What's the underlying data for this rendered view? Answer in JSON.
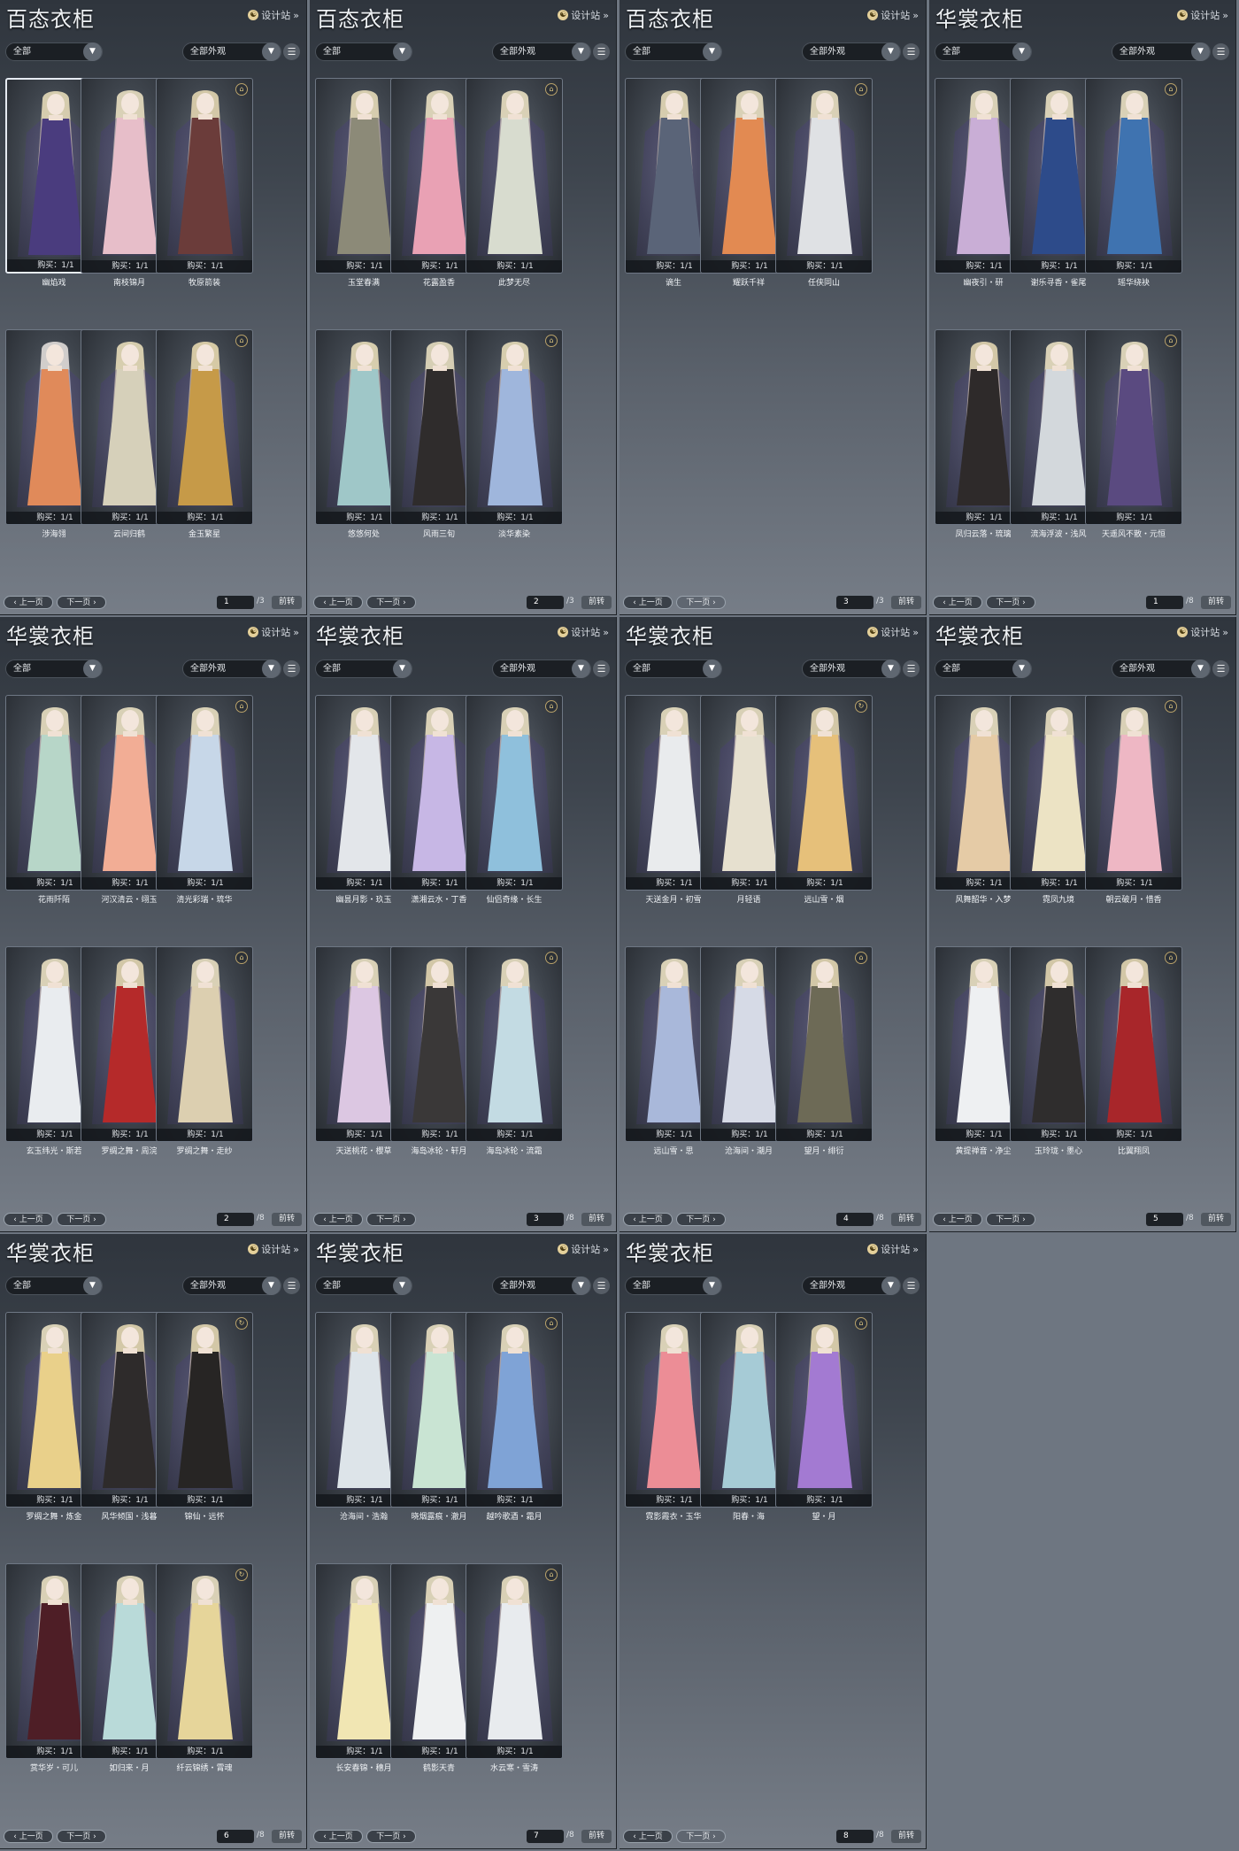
{
  "ui": {
    "design_link": "设计站",
    "filter_all": "全部",
    "filter_all_looks": "全部外观",
    "buy_prefix": "购买：",
    "buy_count": "1/1",
    "prev_page": "上一页",
    "next_page": "下一页",
    "jump": "前转"
  },
  "panels": [
    {
      "title": "百态衣柜",
      "page": "1",
      "total": "/3",
      "next_active": false,
      "selected": 0,
      "items": [
        {
          "name": "幽焰戏",
          "dress": "#4a3c7e",
          "hair": "#e5dab8",
          "icon": "lock"
        },
        {
          "name": "南枝锦月",
          "dress": "#e7bec9",
          "hair": "#e9dfc1",
          "icon": "lock"
        },
        {
          "name": "牧原箭装",
          "dress": "#6b3c3a",
          "hair": "#e2d5b0",
          "icon": "lock"
        },
        {
          "name": "涉海翎",
          "dress": "#e08a5a",
          "hair": "#e0dcd8",
          "icon": "none"
        },
        {
          "name": "云间归鹤",
          "dress": "#d6d0ba",
          "hair": "#e7dcb8",
          "icon": "lock"
        },
        {
          "name": "金玉繁星",
          "dress": "#c69a48",
          "hair": "#e5d7ae",
          "icon": "lock"
        }
      ]
    },
    {
      "title": "百态衣柜",
      "page": "2",
      "total": "/3",
      "next_active": false,
      "selected": -1,
      "items": [
        {
          "name": "玉堂春满",
          "dress": "#8c8a78",
          "hair": "#e5dab8",
          "icon": "lock"
        },
        {
          "name": "花露盈香",
          "dress": "#e9a1b4",
          "hair": "#e9dfc1",
          "icon": "lock"
        },
        {
          "name": "此梦无尽",
          "dress": "#d8dccf",
          "hair": "#e9dfc1",
          "icon": "lock"
        },
        {
          "name": "悠悠何处",
          "dress": "#9fc7c8",
          "hair": "#e7dcb8",
          "icon": "lock"
        },
        {
          "name": "风雨三旬",
          "dress": "#2f2c2c",
          "hair": "#e6ddbf",
          "icon": "lock"
        },
        {
          "name": "淡华素染",
          "dress": "#9fb6dc",
          "hair": "#e7dcb8",
          "icon": "lock"
        }
      ]
    },
    {
      "title": "百态衣柜",
      "page": "3",
      "total": "/3",
      "next_active": true,
      "selected": -1,
      "items": [
        {
          "name": "谪生",
          "dress": "#5a6478",
          "hair": "#e5dab8",
          "icon": "none"
        },
        {
          "name": "耀跃千祥",
          "dress": "#e28a52",
          "hair": "#e9dfc1",
          "icon": "lock"
        },
        {
          "name": "任侠同山",
          "dress": "#dfe1e4",
          "hair": "#e9dfc1",
          "icon": "lock"
        }
      ]
    },
    {
      "title": "华裳衣柜",
      "page": "1",
      "total": "/8",
      "next_active": false,
      "selected": -1,
      "items": [
        {
          "name": "幽夜引・研",
          "dress": "#c9aed6",
          "hair": "#e9dfc1",
          "icon": "lock"
        },
        {
          "name": "谢乐寻香・雀尾",
          "dress": "#2d4b8a",
          "hair": "#e9dfc1",
          "icon": "lock"
        },
        {
          "name": "瑶华绕袂",
          "dress": "#3f73b0",
          "hair": "#e9dfc1",
          "icon": "lock"
        },
        {
          "name": "凤归云落・琉璃",
          "dress": "#2e2a2a",
          "hair": "#e2d5b0",
          "icon": "lock"
        },
        {
          "name": "流海浮波・浅风",
          "dress": "#d3d8dc",
          "hair": "#e9dfc1",
          "icon": "lock"
        },
        {
          "name": "天遥风不散・元恒",
          "dress": "#5a4a80",
          "hair": "#e9dfc1",
          "icon": "lock"
        }
      ]
    },
    {
      "title": "华裳衣柜",
      "page": "2",
      "total": "/8",
      "next_active": false,
      "selected": -1,
      "items": [
        {
          "name": "花雨阡陌",
          "dress": "#b7d6c8",
          "hair": "#e9dfc1",
          "icon": "lock"
        },
        {
          "name": "河汉清云・翊玉",
          "dress": "#f2ad95",
          "hair": "#e9dfc1",
          "icon": "lock"
        },
        {
          "name": "清光彩瑞・琉华",
          "dress": "#c7d7e8",
          "hair": "#e9dfc1",
          "icon": "lock"
        },
        {
          "name": "玄玉纬光・斯若",
          "dress": "#e9ecef",
          "hair": "#e9dfc1",
          "icon": "lock"
        },
        {
          "name": "罗绸之舞・周浣",
          "dress": "#b52a2a",
          "hair": "#e2d5b0",
          "icon": "lock"
        },
        {
          "name": "罗绸之舞・走纱",
          "dress": "#dccfb0",
          "hair": "#e9dfc1",
          "icon": "lock"
        }
      ]
    },
    {
      "title": "华裳衣柜",
      "page": "3",
      "total": "/8",
      "next_active": false,
      "selected": -1,
      "items": [
        {
          "name": "幽昙月影・玖玉",
          "dress": "#e3e6ea",
          "hair": "#e9dfc1",
          "icon": "lock"
        },
        {
          "name": "潇湘云水・丁香",
          "dress": "#c7b7e5",
          "hair": "#e9dfc1",
          "icon": "lock"
        },
        {
          "name": "仙侣奇缘・长生",
          "dress": "#8fc0dc",
          "hair": "#e9dfc1",
          "icon": "lock"
        },
        {
          "name": "天送桃花・櫻草",
          "dress": "#dcc7e2",
          "hair": "#e9dfc1",
          "icon": "lock"
        },
        {
          "name": "海岛冰轮・轩月",
          "dress": "#3a3838",
          "hair": "#e2d5b0",
          "icon": "lock"
        },
        {
          "name": "海岛冰轮・流霜",
          "dress": "#c3dbe3",
          "hair": "#e9dfc1",
          "icon": "lock"
        }
      ]
    },
    {
      "title": "华裳衣柜",
      "page": "4",
      "total": "/8",
      "next_active": false,
      "selected": -1,
      "items": [
        {
          "name": "天送金月・初雪",
          "dress": "#e9ebed",
          "hair": "#e9dfc1",
          "icon": "lock"
        },
        {
          "name": "月轻语",
          "dress": "#e6e0cf",
          "hair": "#e9dfc1",
          "icon": "lock"
        },
        {
          "name": "远山雪・烟",
          "dress": "#e6c07a",
          "hair": "#e2d5b0",
          "icon": "refresh"
        },
        {
          "name": "远山雪・思",
          "dress": "#a9b8da",
          "hair": "#e9dfc1",
          "icon": "refresh"
        },
        {
          "name": "沧海间・潮月",
          "dress": "#d6dae6",
          "hair": "#e9dfc1",
          "icon": "lock"
        },
        {
          "name": "望月・绯衍",
          "dress": "#6d6a56",
          "hair": "#e2d5b0",
          "icon": "lock"
        }
      ]
    },
    {
      "title": "华裳衣柜",
      "page": "5",
      "total": "/8",
      "next_active": false,
      "selected": -1,
      "items": [
        {
          "name": "风舞韶华・入梦",
          "dress": "#e5cba6",
          "hair": "#e9dfc1",
          "icon": "lock"
        },
        {
          "name": "霓凤九境",
          "dress": "#ece3c4",
          "hair": "#e9dfc1",
          "icon": "lock"
        },
        {
          "name": "朝云破月・惜香",
          "dress": "#eeb7c4",
          "hair": "#e9dfc1",
          "icon": "lock"
        },
        {
          "name": "黄提禅音・净尘",
          "dress": "#eef0f2",
          "hair": "#e9dfc1",
          "icon": "lock"
        },
        {
          "name": "玉玲珑・墨心",
          "dress": "#2f2d2d",
          "hair": "#e2d5b0",
          "icon": "lock"
        },
        {
          "name": "比翼翔凤",
          "dress": "#a8262a",
          "hair": "#e2d5b0",
          "icon": "lock"
        }
      ]
    },
    {
      "title": "华裳衣柜",
      "page": "6",
      "total": "/8",
      "next_active": false,
      "selected": -1,
      "items": [
        {
          "name": "罗绸之舞・炼金",
          "dress": "#e9d08a",
          "hair": "#e9dfc1",
          "icon": "lock"
        },
        {
          "name": "风华倾国・浅暮",
          "dress": "#2e2b2b",
          "hair": "#e2d5b0",
          "icon": "lock"
        },
        {
          "name": "锦仙・远怀",
          "dress": "#272524",
          "hair": "#e2d5b0",
          "icon": "refresh"
        },
        {
          "name": "赏华岁・可儿",
          "dress": "#4e1e26",
          "hair": "#e9dfc1",
          "icon": "refresh"
        },
        {
          "name": "如归来・月",
          "dress": "#b9dad9",
          "hair": "#e9dfc1",
          "icon": "lock"
        },
        {
          "name": "纤云锦绣・霄魂",
          "dress": "#e6d59a",
          "hair": "#e9dfc1",
          "icon": "refresh"
        }
      ]
    },
    {
      "title": "华裳衣柜",
      "page": "7",
      "total": "/8",
      "next_active": false,
      "selected": -1,
      "items": [
        {
          "name": "沧海间・浩瀚",
          "dress": "#dde4e9",
          "hair": "#e9dfc1",
          "icon": "refresh"
        },
        {
          "name": "晓烟露痕・澈月",
          "dress": "#c9e4d3",
          "hair": "#e9dfc1",
          "icon": "lock"
        },
        {
          "name": "越吟歌酒・霜月",
          "dress": "#7fa3d6",
          "hair": "#e9dfc1",
          "icon": "lock"
        },
        {
          "name": "长安春锦・穗月",
          "dress": "#f1e6b3",
          "hair": "#e9dfc1",
          "icon": "lock"
        },
        {
          "name": "鹤影天青",
          "dress": "#eef0f1",
          "hair": "#e9dfc1",
          "icon": "lock"
        },
        {
          "name": "水云寒・雪涛",
          "dress": "#e8ebee",
          "hair": "#e9dfc1",
          "icon": "lock"
        }
      ]
    },
    {
      "title": "华裳衣柜",
      "page": "8",
      "total": "/8",
      "next_active": true,
      "selected": -1,
      "items": [
        {
          "name": "霓影霞衣・玉华",
          "dress": "#ec8d96",
          "hair": "#e9dfc1",
          "icon": "refresh"
        },
        {
          "name": "阳春・海",
          "dress": "#a6cbd6",
          "hair": "#e9dfc1",
          "icon": "lock"
        },
        {
          "name": "望・月",
          "dress": "#a37ad2",
          "hair": "#e2d5b0",
          "icon": "lock"
        }
      ]
    }
  ]
}
